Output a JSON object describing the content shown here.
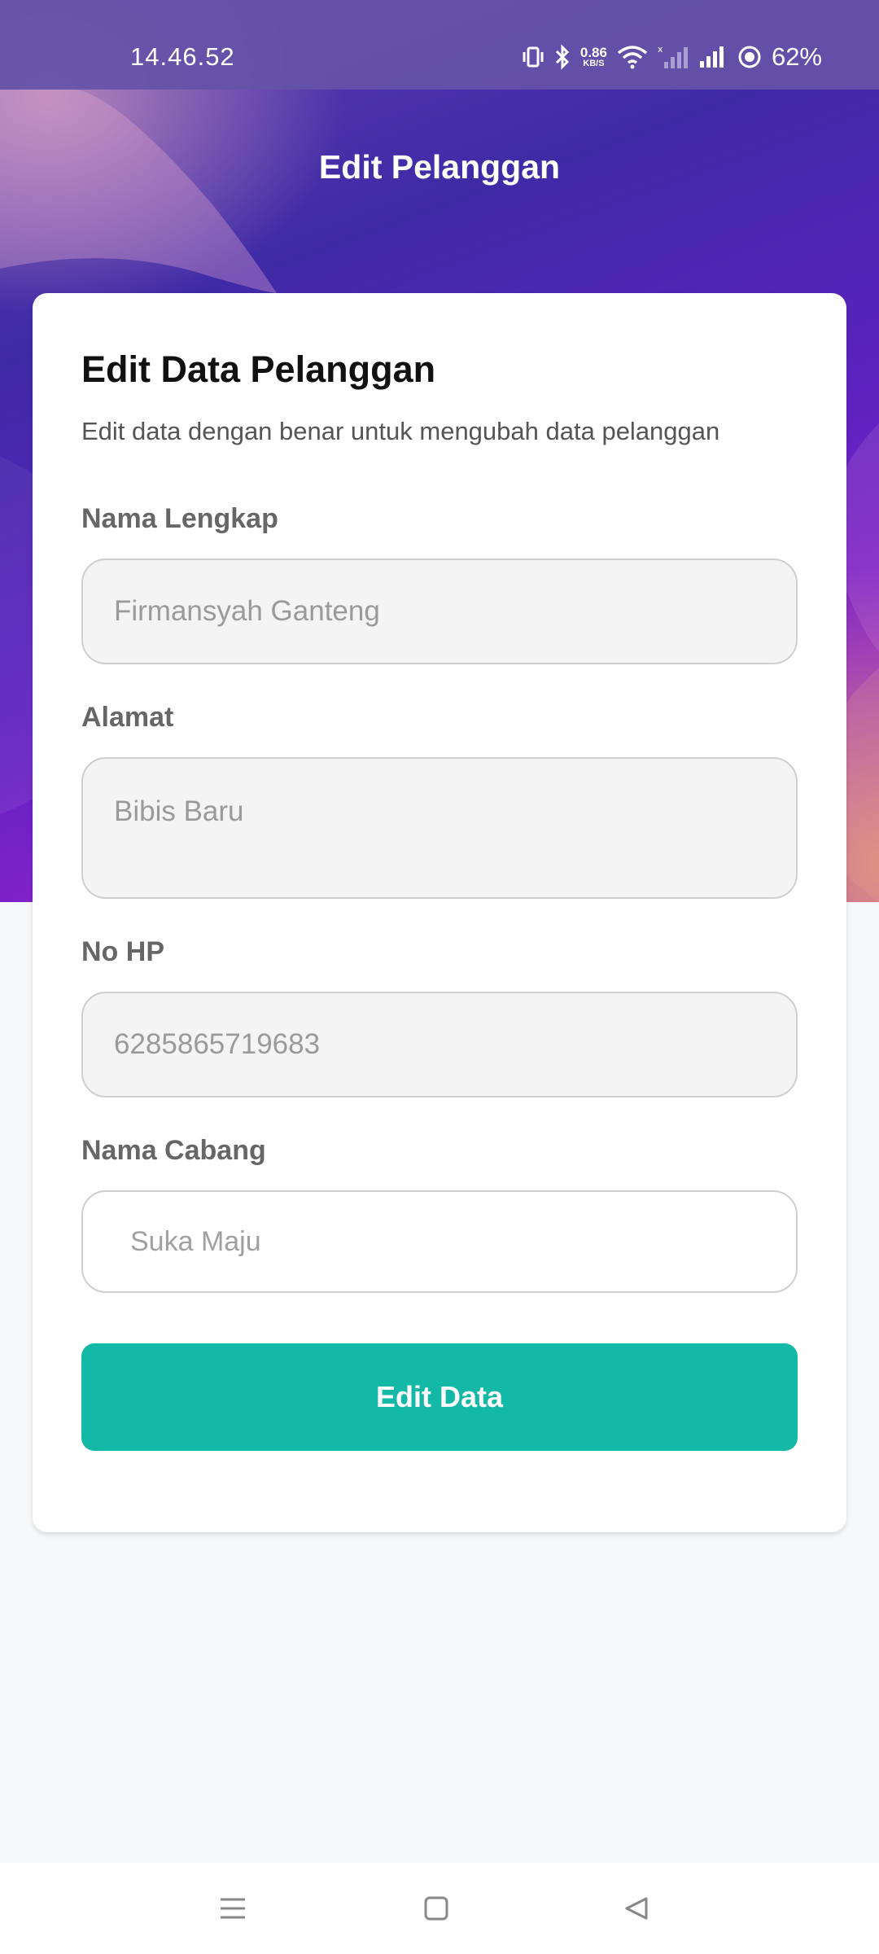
{
  "status_bar": {
    "time": "14.46.52",
    "net_speed_value": "0.86",
    "net_speed_unit": "KB/S",
    "battery": "62%"
  },
  "header": {
    "title": "Edit Pelanggan"
  },
  "form": {
    "title": "Edit Data Pelanggan",
    "subtitle": "Edit data dengan benar untuk mengubah data pelanggan",
    "fields": [
      {
        "label": "Nama Lengkap",
        "value": "Firmansyah Ganteng"
      },
      {
        "label": "Alamat",
        "value": "Bibis Baru"
      },
      {
        "label": "No HP",
        "value": "6285865719683"
      },
      {
        "label": "Nama Cabang",
        "value": "Suka Maju"
      }
    ],
    "submit_label": "Edit Data"
  },
  "colors": {
    "accent": "#14b8a6",
    "header_gradient": "#4a2ab0"
  },
  "nav": {
    "icons": [
      "menu-icon",
      "home-icon",
      "back-icon"
    ]
  }
}
